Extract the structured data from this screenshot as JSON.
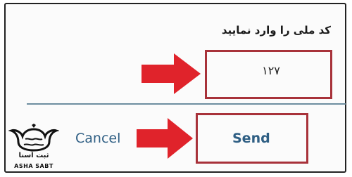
{
  "dialog": {
    "prompt": "کد ملی را وارد نمایید",
    "code_value": "۱۲۷",
    "cancel_label": "Cancel",
    "send_label": "Send"
  },
  "watermark": {
    "title": "ثبت آسنا",
    "subtitle": "ASHA SABT"
  },
  "colors": {
    "highlight": "#a8323a",
    "arrow": "#e0232b",
    "button_text": "#2f5f84",
    "divider": "#6e8ea0"
  },
  "icons": [
    "right-arrow-icon",
    "right-arrow-icon",
    "crown-logo-icon"
  ]
}
